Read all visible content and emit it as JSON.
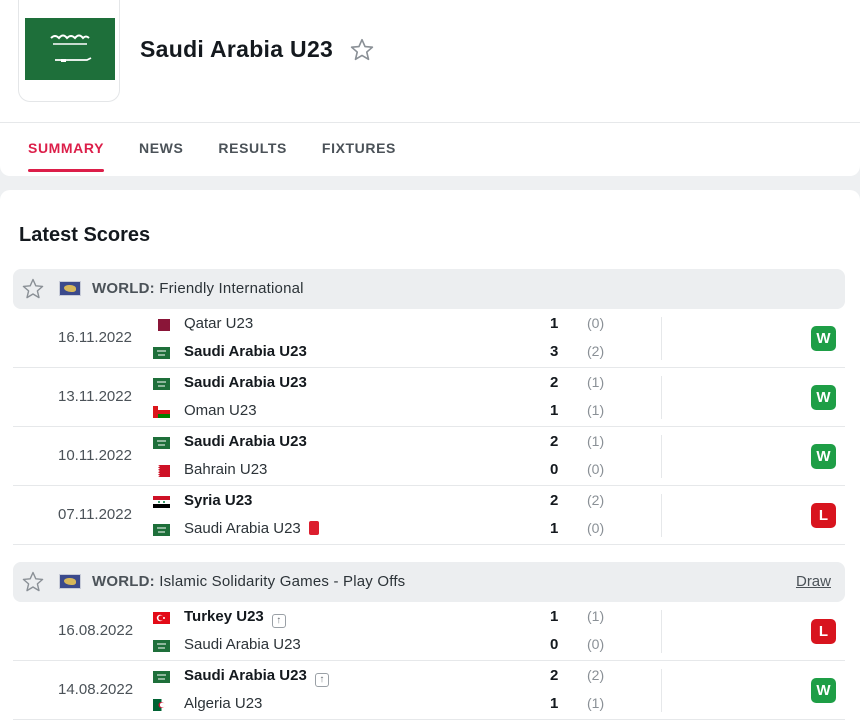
{
  "team": {
    "name": "Saudi Arabia U23",
    "flag_color": "#1e6f3a"
  },
  "tabs": [
    {
      "label": "SUMMARY",
      "active": true
    },
    {
      "label": "NEWS",
      "active": false
    },
    {
      "label": "RESULTS",
      "active": false
    },
    {
      "label": "FIXTURES",
      "active": false
    }
  ],
  "section_title": "Latest Scores",
  "leagues": [
    {
      "country": "WORLD:",
      "name": "Friendly International",
      "extra_link": "",
      "matches": [
        {
          "date": "16.11.2022",
          "home": {
            "name": "Qatar U23",
            "flag": "qatar",
            "score": "1",
            "ht": "(0)",
            "bold": false
          },
          "away": {
            "name": "Saudi Arabia U23",
            "flag": "saudi",
            "score": "3",
            "ht": "(2)",
            "bold": true
          },
          "result": "W"
        },
        {
          "date": "13.11.2022",
          "home": {
            "name": "Saudi Arabia U23",
            "flag": "saudi",
            "score": "2",
            "ht": "(1)",
            "bold": true
          },
          "away": {
            "name": "Oman U23",
            "flag": "oman",
            "score": "1",
            "ht": "(1)",
            "bold": false
          },
          "result": "W"
        },
        {
          "date": "10.11.2022",
          "home": {
            "name": "Saudi Arabia U23",
            "flag": "saudi",
            "score": "2",
            "ht": "(1)",
            "bold": true
          },
          "away": {
            "name": "Bahrain U23",
            "flag": "bahrain",
            "score": "0",
            "ht": "(0)",
            "bold": false
          },
          "result": "W"
        },
        {
          "date": "07.11.2022",
          "home": {
            "name": "Syria U23",
            "flag": "syria",
            "score": "2",
            "ht": "(2)",
            "bold": true
          },
          "away": {
            "name": "Saudi Arabia U23",
            "flag": "saudi",
            "score": "1",
            "ht": "(0)",
            "bold": false,
            "red_card": true
          },
          "result": "L"
        }
      ]
    },
    {
      "country": "WORLD:",
      "name": "Islamic Solidarity Games - Play Offs",
      "extra_link": "Draw",
      "matches": [
        {
          "date": "16.08.2022",
          "home": {
            "name": "Turkey U23",
            "flag": "turkey",
            "score": "1",
            "ht": "(1)",
            "bold": true,
            "advanced": true
          },
          "away": {
            "name": "Saudi Arabia U23",
            "flag": "saudi",
            "score": "0",
            "ht": "(0)",
            "bold": false
          },
          "result": "L"
        },
        {
          "date": "14.08.2022",
          "home": {
            "name": "Saudi Arabia U23",
            "flag": "saudi",
            "score": "2",
            "ht": "(2)",
            "bold": true,
            "advanced": true
          },
          "away": {
            "name": "Algeria U23",
            "flag": "algeria",
            "score": "1",
            "ht": "(1)",
            "bold": false
          },
          "result": "W"
        }
      ]
    }
  ],
  "colors": {
    "accent": "#dc1e49",
    "win": "#1e9e46",
    "loss": "#d8141e"
  }
}
